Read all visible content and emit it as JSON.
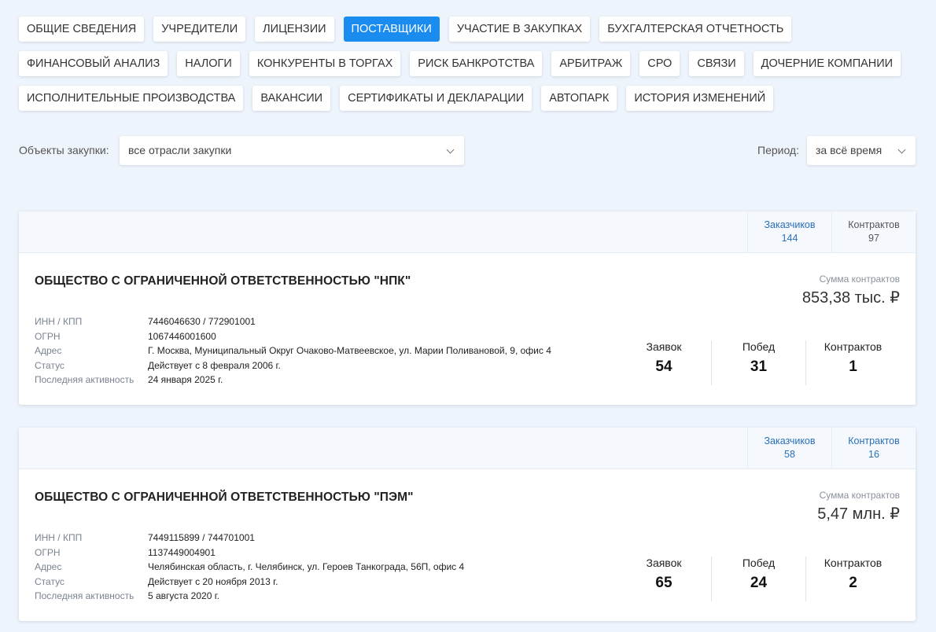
{
  "tabs": [
    {
      "label": "Общие сведения"
    },
    {
      "label": "Учредители"
    },
    {
      "label": "Лицензии"
    },
    {
      "label": "Поставщики",
      "active": true
    },
    {
      "label": "Участие в закупках"
    },
    {
      "label": "Бухгалтерская отчетность"
    },
    {
      "label": "Финансовый анализ"
    },
    {
      "label": "Налоги"
    },
    {
      "label": "Конкуренты в торгах"
    },
    {
      "label": "Риск банкротства"
    },
    {
      "label": "Арбитраж"
    },
    {
      "label": "СРО"
    },
    {
      "label": "Связи"
    },
    {
      "label": "Дочерние компании"
    },
    {
      "label": "Исполнительные производства"
    },
    {
      "label": "Вакансии"
    },
    {
      "label": "Сертификаты и декларации"
    },
    {
      "label": "Автопарк"
    },
    {
      "label": "История изменений"
    }
  ],
  "filters": {
    "objects_label": "Объекты закупки:",
    "objects_value": "все отрасли закупки",
    "period_label": "Период:",
    "period_value": "за всё время"
  },
  "cards": [
    {
      "customers_label": "Заказчиков",
      "customers": "144",
      "contracts_label": "Контрактов",
      "contracts": "97",
      "name": "ОБЩЕСТВО С ОГРАНИЧЕННОЙ ОТВЕТСТВЕННОСТЬЮ \"НПК\"",
      "details": [
        {
          "label": "ИНН / КПП",
          "value": "7446046630 / 772901001"
        },
        {
          "label": "ОГРН",
          "value": "1067446001600"
        },
        {
          "label": "Адрес",
          "value": "Г. Москва, Муниципальный Округ Очаково-Матвеевское, ул. Марии Поливановой, 9, офис 4"
        },
        {
          "label": "Статус",
          "value": "Действует с 8 февраля 2006 г."
        },
        {
          "label": "Последняя активность",
          "value": "24 января 2025 г."
        }
      ],
      "sum_label": "Сумма контрактов",
      "sum": "853,38 тыс. ₽",
      "stats": [
        {
          "label": "Заявок",
          "value": "54"
        },
        {
          "label": "Побед",
          "value": "31"
        },
        {
          "label": "Контрактов",
          "value": "1"
        }
      ]
    },
    {
      "customers_label": "Заказчиков",
      "customers": "58",
      "contracts_label": "Контрактов",
      "contracts": "16",
      "name": "ОБЩЕСТВО С ОГРАНИЧЕННОЙ ОТВЕТСТВЕННОСТЬЮ \"ПЭМ\"",
      "details": [
        {
          "label": "ИНН / КПП",
          "value": "7449115899 / 744701001"
        },
        {
          "label": "ОГРН",
          "value": "1137449004901"
        },
        {
          "label": "Адрес",
          "value": "Челябинская область, г. Челябинск, ул. Героев Танкограда, 56П, офис 4"
        },
        {
          "label": "Статус",
          "value": "Действует с 20 ноября 2013 г."
        },
        {
          "label": "Последняя активность",
          "value": "5 августа 2020 г."
        }
      ],
      "sum_label": "Сумма контрактов",
      "sum": "5,47 млн. ₽",
      "stats": [
        {
          "label": "Заявок",
          "value": "65"
        },
        {
          "label": "Побед",
          "value": "24"
        },
        {
          "label": "Контрактов",
          "value": "2"
        }
      ]
    }
  ]
}
